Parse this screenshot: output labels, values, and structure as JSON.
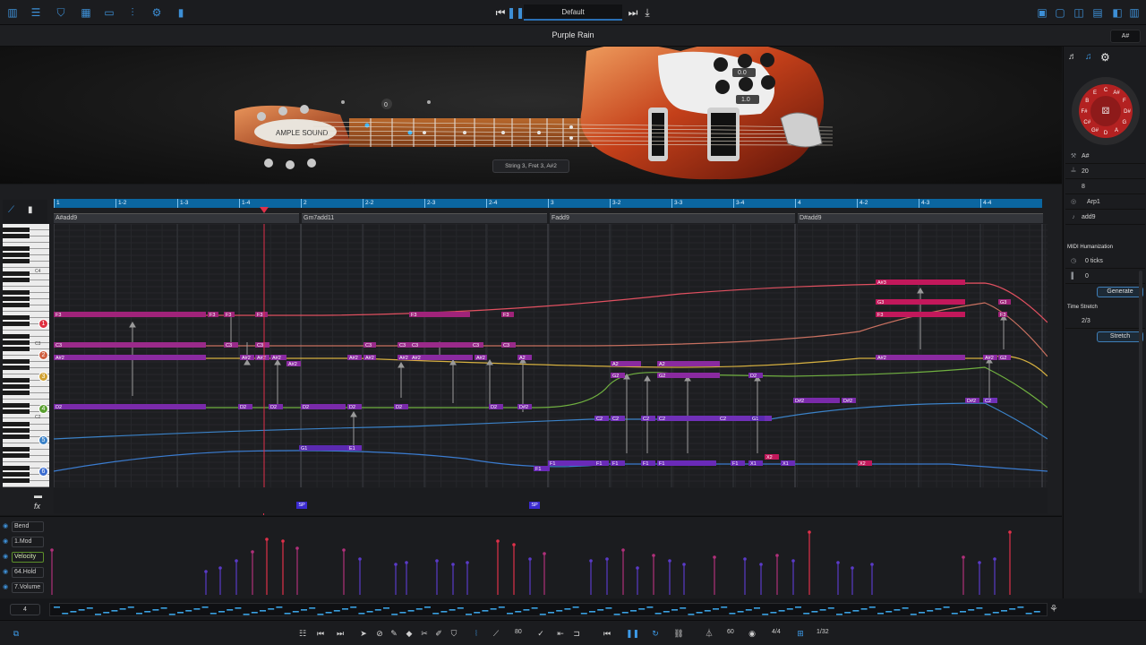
{
  "colors": {
    "accent": "#3d8fd6",
    "ruler": "#0b66a0",
    "note_red": "#c2185b",
    "note_purple": "#5b2aa8"
  },
  "topbar": {
    "icons": [
      "piano-roll-icon",
      "mixer-icon",
      "shield-icon",
      "grid-icon",
      "window-icon",
      "eq-icon",
      "gear-icon",
      "bars-icon"
    ],
    "preset": "Default",
    "right_icons": [
      "layout-1-icon",
      "layout-2-icon",
      "layout-3-icon",
      "layout-4-icon",
      "layout-5-icon"
    ]
  },
  "title": {
    "song": "Purple Rain",
    "key": "A#"
  },
  "stage": {
    "fret_marker": "0",
    "knob_values": [
      "0.0",
      "1.0"
    ],
    "string_info": "String 3, Fret 3, A#2"
  },
  "editor": {
    "ruler": [
      "1",
      "1-2",
      "1-3",
      "1-4",
      "2",
      "2-2",
      "2-3",
      "2-4",
      "3",
      "3-2",
      "3-3",
      "3-4",
      "4",
      "4-2",
      "4-3",
      "4-4"
    ],
    "chords": [
      {
        "name": "A#add9"
      },
      {
        "name": "Gm7add11"
      },
      {
        "name": "Fadd9"
      },
      {
        "name": "D#add9"
      }
    ],
    "piano_labels": [
      "C4",
      "C3",
      "C2"
    ],
    "string_numbers": [
      "1",
      "2",
      "3",
      "4",
      "5",
      "6"
    ],
    "notes": [
      {
        "t": "F3",
        "s": 1
      },
      {
        "t": "F3",
        "s": 1
      },
      {
        "t": "F3",
        "s": 1
      },
      {
        "t": "F3",
        "s": 1
      },
      {
        "t": "F3",
        "s": 1
      },
      {
        "t": "F3",
        "s": 1
      },
      {
        "t": "A#3",
        "s": 0
      },
      {
        "t": "G3",
        "s": 0
      },
      {
        "t": "F3",
        "s": 0
      },
      {
        "t": "G3",
        "s": 1
      },
      {
        "t": "F3",
        "s": 1
      },
      {
        "t": "C3",
        "s": 2
      },
      {
        "t": "C3",
        "s": 2
      },
      {
        "t": "C3",
        "s": 2
      },
      {
        "t": "C3",
        "s": 2
      },
      {
        "t": "C3",
        "s": 2
      },
      {
        "t": "C3",
        "s": 2
      },
      {
        "t": "C3",
        "s": 2
      },
      {
        "t": "C3",
        "s": 2
      },
      {
        "t": "A#2",
        "s": 3
      },
      {
        "t": "A#2",
        "s": 3
      },
      {
        "t": "A#2",
        "s": 3
      },
      {
        "t": "A#2",
        "s": 3
      },
      {
        "t": "A#2",
        "s": 3
      },
      {
        "t": "A#2",
        "s": 3
      },
      {
        "t": "A#2",
        "s": 3
      },
      {
        "t": "A#2",
        "s": 3
      },
      {
        "t": "A#2",
        "s": 3
      },
      {
        "t": "A#2",
        "s": 3
      },
      {
        "t": "A2",
        "s": 3
      },
      {
        "t": "A2",
        "s": 3
      },
      {
        "t": "A2",
        "s": 3
      },
      {
        "t": "A#2",
        "s": 3
      },
      {
        "t": "A#2",
        "s": 3
      },
      {
        "t": "A#2",
        "s": 3
      },
      {
        "t": "G2",
        "s": 4
      },
      {
        "t": "G2",
        "s": 4
      },
      {
        "t": "G2",
        "s": 4
      },
      {
        "t": "D2",
        "s": 5
      },
      {
        "t": "D2",
        "s": 5
      },
      {
        "t": "D2",
        "s": 5
      },
      {
        "t": "D2",
        "s": 5
      },
      {
        "t": "D2",
        "s": 5
      },
      {
        "t": "D2",
        "s": 5
      },
      {
        "t": "D2",
        "s": 5
      },
      {
        "t": "D2",
        "s": 5
      },
      {
        "t": "D#2",
        "s": 5
      },
      {
        "t": "D#2",
        "s": 5
      },
      {
        "t": "D#2",
        "s": 5
      },
      {
        "t": "D#2",
        "s": 5
      },
      {
        "t": "C2",
        "s": 6
      },
      {
        "t": "C2",
        "s": 6
      },
      {
        "t": "C2",
        "s": 6
      },
      {
        "t": "C2",
        "s": 6
      },
      {
        "t": "C2",
        "s": 6
      },
      {
        "t": "C2",
        "s": 6
      },
      {
        "t": "G1",
        "s": 7
      },
      {
        "t": "G1",
        "s": 7
      },
      {
        "t": "E1",
        "s": 8
      },
      {
        "t": "F1",
        "s": 8
      },
      {
        "t": "F1",
        "s": 8
      },
      {
        "t": "F1",
        "s": 8
      },
      {
        "t": "F1",
        "s": 8
      },
      {
        "t": "F1",
        "s": 8
      },
      {
        "t": "F1",
        "s": 8
      },
      {
        "t": "F1",
        "s": 8
      },
      {
        "t": "X1",
        "s": 8
      },
      {
        "t": "X1",
        "s": 8
      },
      {
        "t": "X2",
        "s": 9
      },
      {
        "t": "X2",
        "s": 9
      }
    ],
    "fx_markers": [
      "SP",
      "SP"
    ]
  },
  "controllers": {
    "buttons": [
      "Bend",
      "1.Mod",
      "Velocity",
      "64.Hold",
      "7.Volume"
    ],
    "active": "Velocity"
  },
  "right_panel": {
    "tabs": [
      "strum-icon",
      "note-icon",
      "gear-icon"
    ],
    "wheel": [
      "C",
      "A#",
      "F",
      "D#",
      "G",
      "A",
      "D",
      "G#",
      "C#",
      "F#",
      "B",
      "E"
    ],
    "rows": [
      {
        "icon": "wrench-icon",
        "value": "A#"
      },
      {
        "icon": "ruler-icon",
        "value": "20"
      },
      {
        "icon": "",
        "value": "8"
      },
      {
        "icon": "arp-icon",
        "value": "Arp1"
      },
      {
        "icon": "note-icon",
        "value": "add9"
      }
    ],
    "midi_humanization": "MIDI Humanization",
    "ticks": "0 ticks",
    "vel_humanize": "0",
    "generate": "Generate",
    "time_stretch": "Time Stretch",
    "stretch_ratio": "2/3",
    "stretch": "Stretch"
  },
  "overview": {
    "beat": "4"
  },
  "bottombar": {
    "tempo": "80",
    "signature": "4/4",
    "metronome": "60",
    "quantize": "1/32"
  }
}
